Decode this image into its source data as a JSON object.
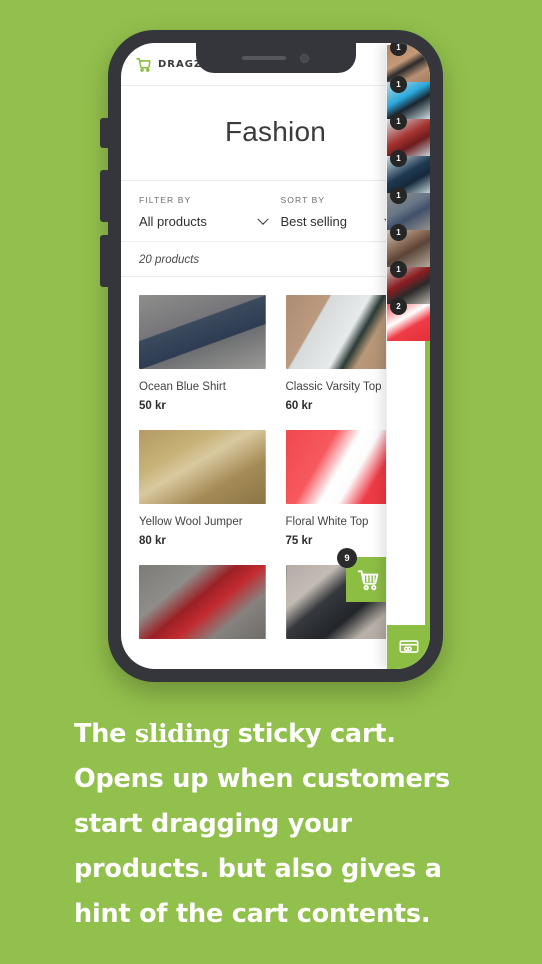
{
  "theme": {
    "background_green": "#92c04c",
    "accent_green": "#8dbe44",
    "badge_dark": "#2b2b2b",
    "phone_body": "#34363c"
  },
  "phone": {
    "store": {
      "brand": {
        "name": "DRAGZONE",
        "logo_icon": "shopping-cart-icon"
      },
      "menu_icon": "hamburger-menu-icon",
      "page_title": "Fashion",
      "filter": {
        "filter_label": "FILTER BY",
        "filter_value": "All products",
        "sort_label": "SORT BY",
        "sort_value": "Best selling",
        "chevron_icon": "chevron-down-icon"
      },
      "product_count": "20 products",
      "products": [
        {
          "name": "Ocean Blue Shirt",
          "price": "50 kr",
          "image_class": "img-ocean"
        },
        {
          "name": "Classic Varsity Top",
          "price": "60 kr",
          "image_class": "img-varsity"
        },
        {
          "name": "Yellow Wool Jumper",
          "price": "80 kr",
          "image_class": "img-yellow"
        },
        {
          "name": "Floral White Top",
          "price": "75 kr",
          "image_class": "img-floral"
        },
        {
          "name": "",
          "price": "",
          "image_class": "img-red-dress"
        },
        {
          "name": "",
          "price": "",
          "image_class": "img-leather"
        }
      ]
    },
    "cart_fab": {
      "icon": "shopping-cart-icon",
      "badge": "9"
    },
    "sticky_cart": {
      "items": [
        {
          "badge": "1",
          "thumb_class": "ci-a"
        },
        {
          "badge": "1",
          "thumb_class": "ci-b"
        },
        {
          "badge": "1",
          "thumb_class": "ci-c"
        },
        {
          "badge": "1",
          "thumb_class": "ci-d"
        },
        {
          "badge": "1",
          "thumb_class": "ci-e"
        },
        {
          "badge": "1",
          "thumb_class": "ci-f"
        },
        {
          "badge": "1",
          "thumb_class": "ci-g"
        },
        {
          "badge": "2",
          "thumb_class": "ci-h"
        }
      ],
      "checkout_icon": "credit-card-icon"
    }
  },
  "caption": {
    "line1_part1": "The ",
    "line1_emphasis": "sliding",
    "line1_part2": " sticky cart.",
    "line2": "Opens up when customers",
    "line3": "start dragging your",
    "line4": "products. but also gives a",
    "line5": "hint of the cart contents."
  }
}
